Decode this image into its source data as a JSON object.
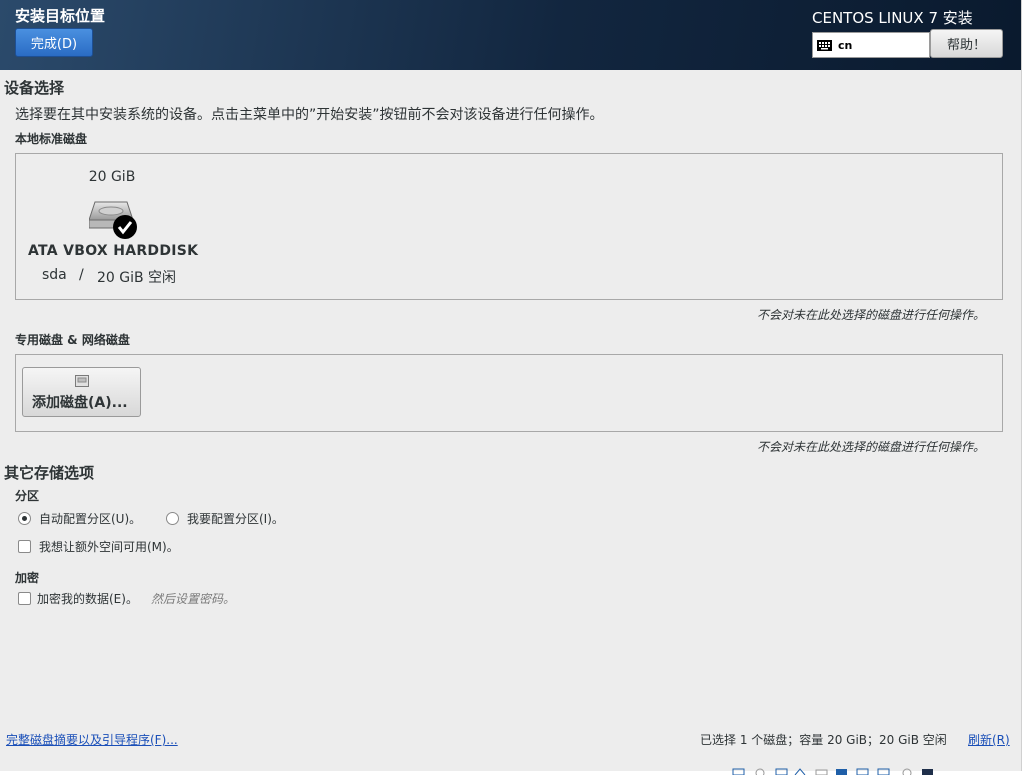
{
  "header": {
    "title": "安装目标位置",
    "done_label": "完成(D)",
    "product_title": "CENTOS LINUX 7 安装",
    "keyboard_layout": "cn",
    "help_label": "帮助！"
  },
  "device_selection": {
    "title": "设备选择",
    "description": "选择要在其中安装系统的设备。点击主菜单中的”开始安装”按钮前不会对该设备进行任何操作。",
    "local_disks": {
      "title": "本地标准磁盘",
      "disks": [
        {
          "size": "20 GiB",
          "model": "ATA VBOX HARDDISK",
          "device": "sda",
          "separator": "/",
          "free": "20 GiB 空闲",
          "selected": true
        }
      ],
      "note": "不会对未在此处选择的磁盘进行任何操作。"
    },
    "specialized_disks": {
      "title": "专用磁盘 & 网络磁盘",
      "add_disk_label": "添加磁盘(A)...",
      "note": "不会对未在此处选择的磁盘进行任何操作。"
    }
  },
  "other_storage": {
    "title": "其它存储选项",
    "partitioning": {
      "title": "分区",
      "auto_label": "自动配置分区(U)。",
      "manual_label": "我要配置分区(I)。",
      "selected": "auto",
      "extra_space_label": "我想让额外空间可用(M)。",
      "extra_space_checked": false
    },
    "encryption": {
      "title": "加密",
      "encrypt_label": "加密我的数据(E)。",
      "encrypt_hint": "然后设置密码。",
      "encrypt_checked": false
    }
  },
  "footer": {
    "summary_link": "完整磁盘摘要以及引导程序(F)...",
    "selection_summary": "已选择 1 个磁盘；容量 20 GiB；20 GiB 空闲",
    "refresh_link": "刷新(R)"
  },
  "colors": {
    "header_bg": "#12263f",
    "done_button": "#2a6cc4",
    "link": "#1a4fb8",
    "panel_bg": "#ededed"
  }
}
